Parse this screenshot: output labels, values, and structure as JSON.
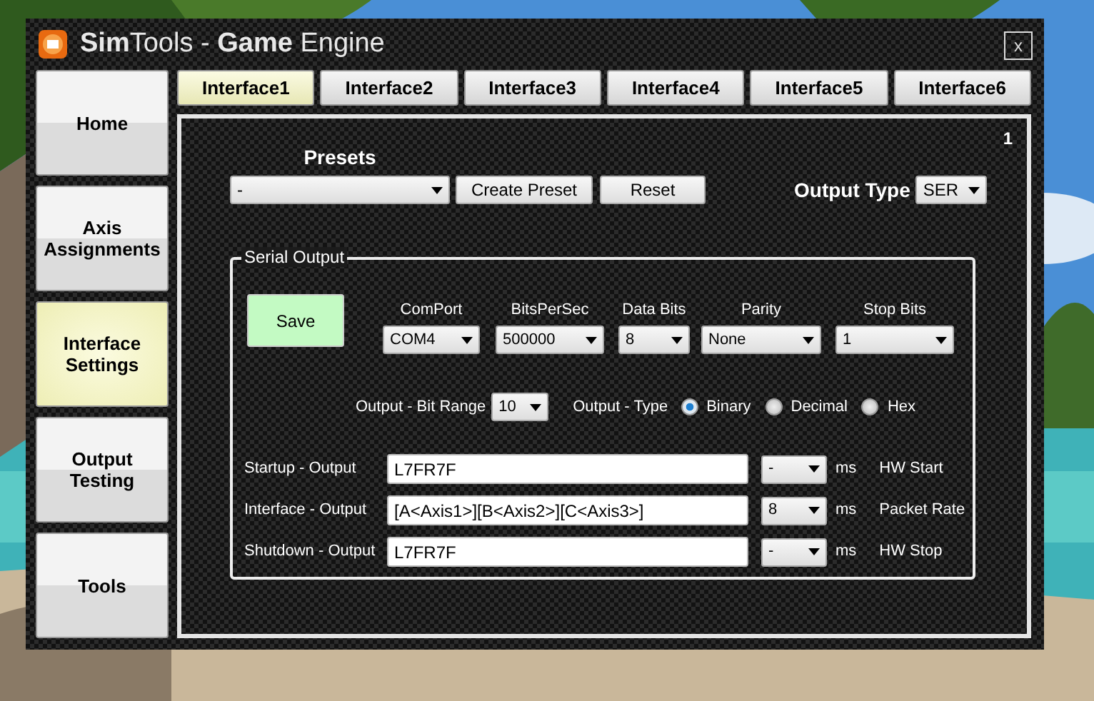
{
  "window": {
    "title": "**Sim**Tools - **Game** Engine",
    "close": "x"
  },
  "sidebar": {
    "items": [
      {
        "label": "Home",
        "selected": false
      },
      {
        "label": "Axis Assignments",
        "selected": false
      },
      {
        "label": "Interface Settings",
        "selected": true
      },
      {
        "label": "Output Testing",
        "selected": false
      },
      {
        "label": "Tools",
        "selected": false
      }
    ]
  },
  "tabs": [
    {
      "label": "Interface1",
      "selected": true
    },
    {
      "label": "Interface2",
      "selected": false
    },
    {
      "label": "Interface3",
      "selected": false
    },
    {
      "label": "Interface4",
      "selected": false
    },
    {
      "label": "Interface5",
      "selected": false
    },
    {
      "label": "Interface6",
      "selected": false
    }
  ],
  "panel": {
    "number": "1",
    "presets_label": "Presets",
    "preset_value": "-",
    "buttons": [
      "Create Preset",
      "Reset"
    ],
    "output_type_label": "Output Type",
    "output_type_value": "SER",
    "serial_output": {
      "title": "Serial Output",
      "save_button": "Save",
      "settings": [
        {
          "label": "ComPort",
          "value": "COM4"
        },
        {
          "label": "BitsPerSec",
          "value": "500000"
        },
        {
          "label": "Data Bits",
          "value": "8"
        },
        {
          "label": "Parity",
          "value": "None"
        },
        {
          "label": "Stop Bits",
          "value": "1"
        }
      ],
      "bit_range_label": "Output - Bit Range",
      "bit_range_value": "10",
      "type_label": "Output - Type",
      "type_options": [
        {
          "label": "Binary",
          "selected": true
        },
        {
          "label": "Decimal",
          "selected": false
        },
        {
          "label": "Hex",
          "selected": false
        }
      ],
      "outputs": [
        {
          "label": "Startup - Output",
          "value": "L7FR7F",
          "time": "-",
          "unit": "ms",
          "note": "HW Start"
        },
        {
          "label": "Interface - Output",
          "value": "[A<Axis1>][B<Axis2>][C<Axis3>]",
          "time": "8",
          "unit": "ms",
          "note": "Packet Rate"
        },
        {
          "label": "Shutdown - Output",
          "value": "L7FR7F",
          "time": "-",
          "unit": "ms",
          "note": "HW Stop"
        }
      ]
    }
  }
}
